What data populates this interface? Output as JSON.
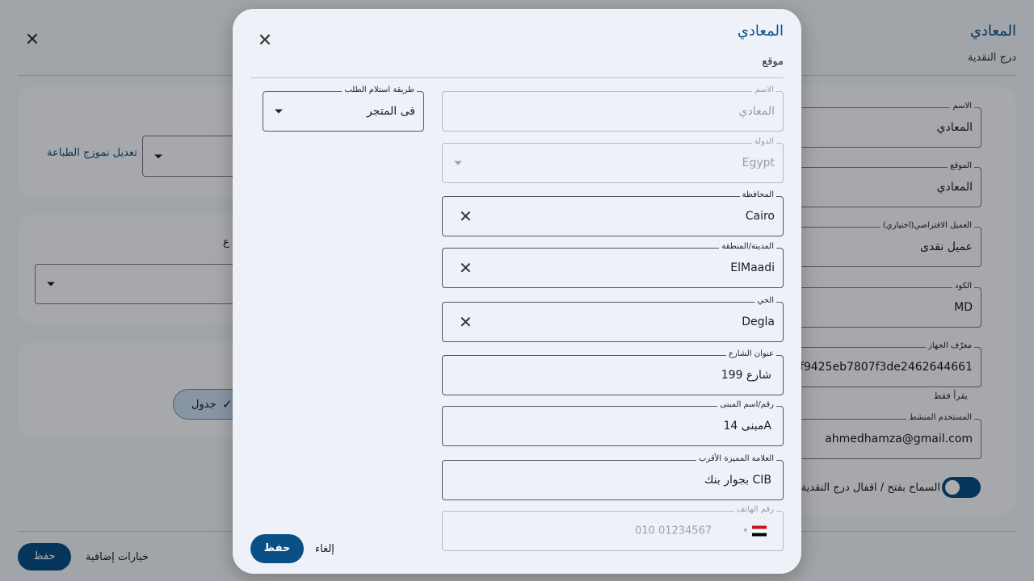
{
  "background": {
    "title": "المعادي",
    "subtitle": "درج النقدية",
    "print_template_link": "تعديل نموزج الطباعة",
    "fields": [
      {
        "label": "الاسم",
        "value": "المعادي"
      },
      {
        "label": "الموقع",
        "value": "المعادي"
      },
      {
        "label": "العميل الافتراضي(اختياري)",
        "value": "عميل نقدى"
      },
      {
        "label": "الكود",
        "value": "MD"
      },
      {
        "label": "معرّف الجهاز",
        "value": "2edf9425eb7807f3de2462644661"
      },
      {
        "label": "المستخدم المنشط",
        "value": "ahmedhamza@gmail.com"
      }
    ],
    "read_only_hint": "يقرأ فقط",
    "partial_label": "ع",
    "chip_label": "جدول",
    "toggle_label": "السماح بفتح / اقفال درج النقدية",
    "save_label": "حفظ",
    "more_options_label": "خيارات إضافية"
  },
  "dialog": {
    "title": "المعادي",
    "subtitle": "موقع",
    "receive_method": {
      "label": "طريقة استلام الطلب",
      "value": "فى المتجر"
    },
    "name": {
      "label": "الاسم",
      "value": "المعادي"
    },
    "country": {
      "label": "الدولة",
      "value": "Egypt"
    },
    "governorate": {
      "label": "المحافظة",
      "value": "Cairo"
    },
    "city": {
      "label": "المدينة/المنطقة",
      "value": "ElMaadi"
    },
    "district": {
      "label": "الحي",
      "value": "Degla"
    },
    "street": {
      "label": "عنوان الشارع",
      "value": "شارع 199"
    },
    "building": {
      "label": "رقم/اسم المبنى",
      "value": "مبنى 14A"
    },
    "landmark": {
      "label": "العلامة المميزة الأقرب",
      "value": "بجوار بنك CIB"
    },
    "phone": {
      "label": "رقم الهاتف",
      "placeholder": "010 01234567"
    },
    "save_label": "حفظ",
    "cancel_label": "إلغاء"
  },
  "colors": {
    "accent": "#0a4f86",
    "surface": "#eef2f8"
  }
}
